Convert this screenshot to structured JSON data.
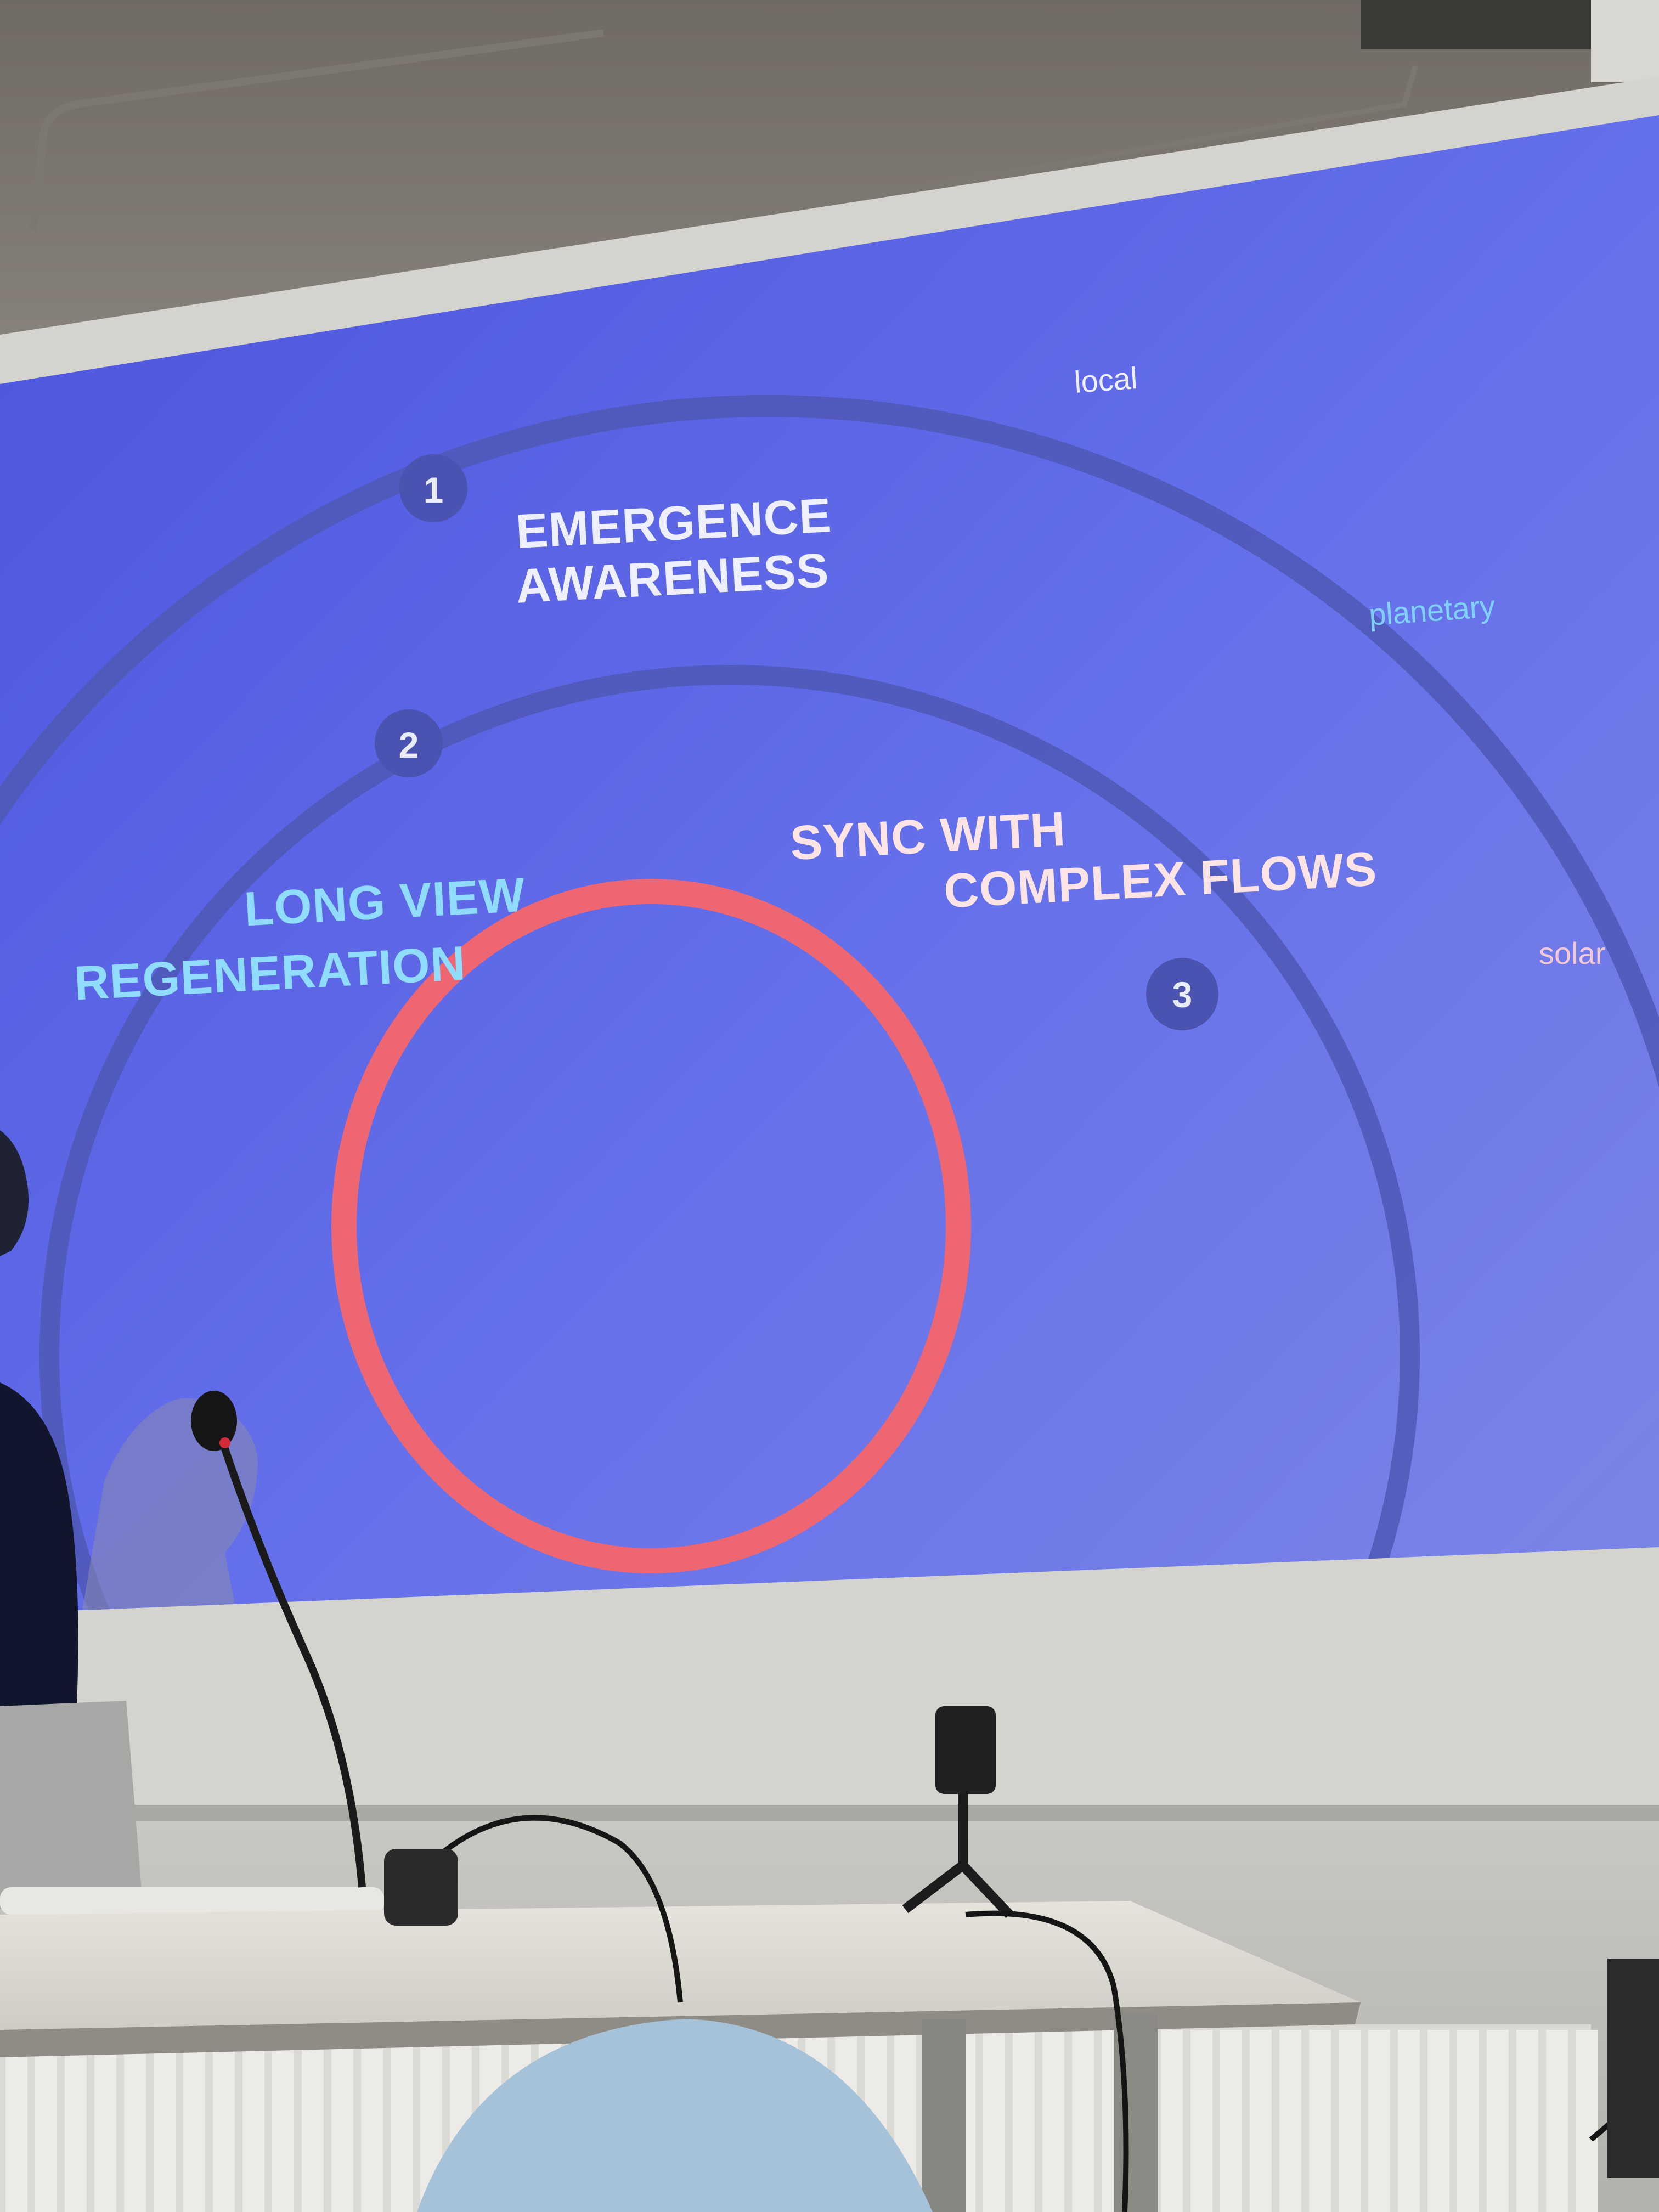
{
  "slide": {
    "scales": {
      "local": "local",
      "planetary": "planetary",
      "solar": "solar"
    },
    "phases": [
      {
        "number": "1",
        "line1": "EMERGENCE",
        "line2": "AWARENESS"
      },
      {
        "number": "2",
        "line1": "LONG VIEW",
        "line2": "REGENERATION"
      },
      {
        "number": "3",
        "line1": "SYNC WITH",
        "line2": "COMPLEX FLOWS"
      }
    ]
  },
  "colors": {
    "slide_background": "#5b64e0",
    "orbit_ring": "#4e57b8",
    "core_ring": "#ef6673",
    "phase1_text": "#eef0ff",
    "phase2_text": "#8fdcff",
    "phase3_text": "#fbe3e6",
    "scale_local": "#eef0ff",
    "scale_planetary": "#7fd2ff",
    "scale_solar": "#f3c9d4"
  }
}
